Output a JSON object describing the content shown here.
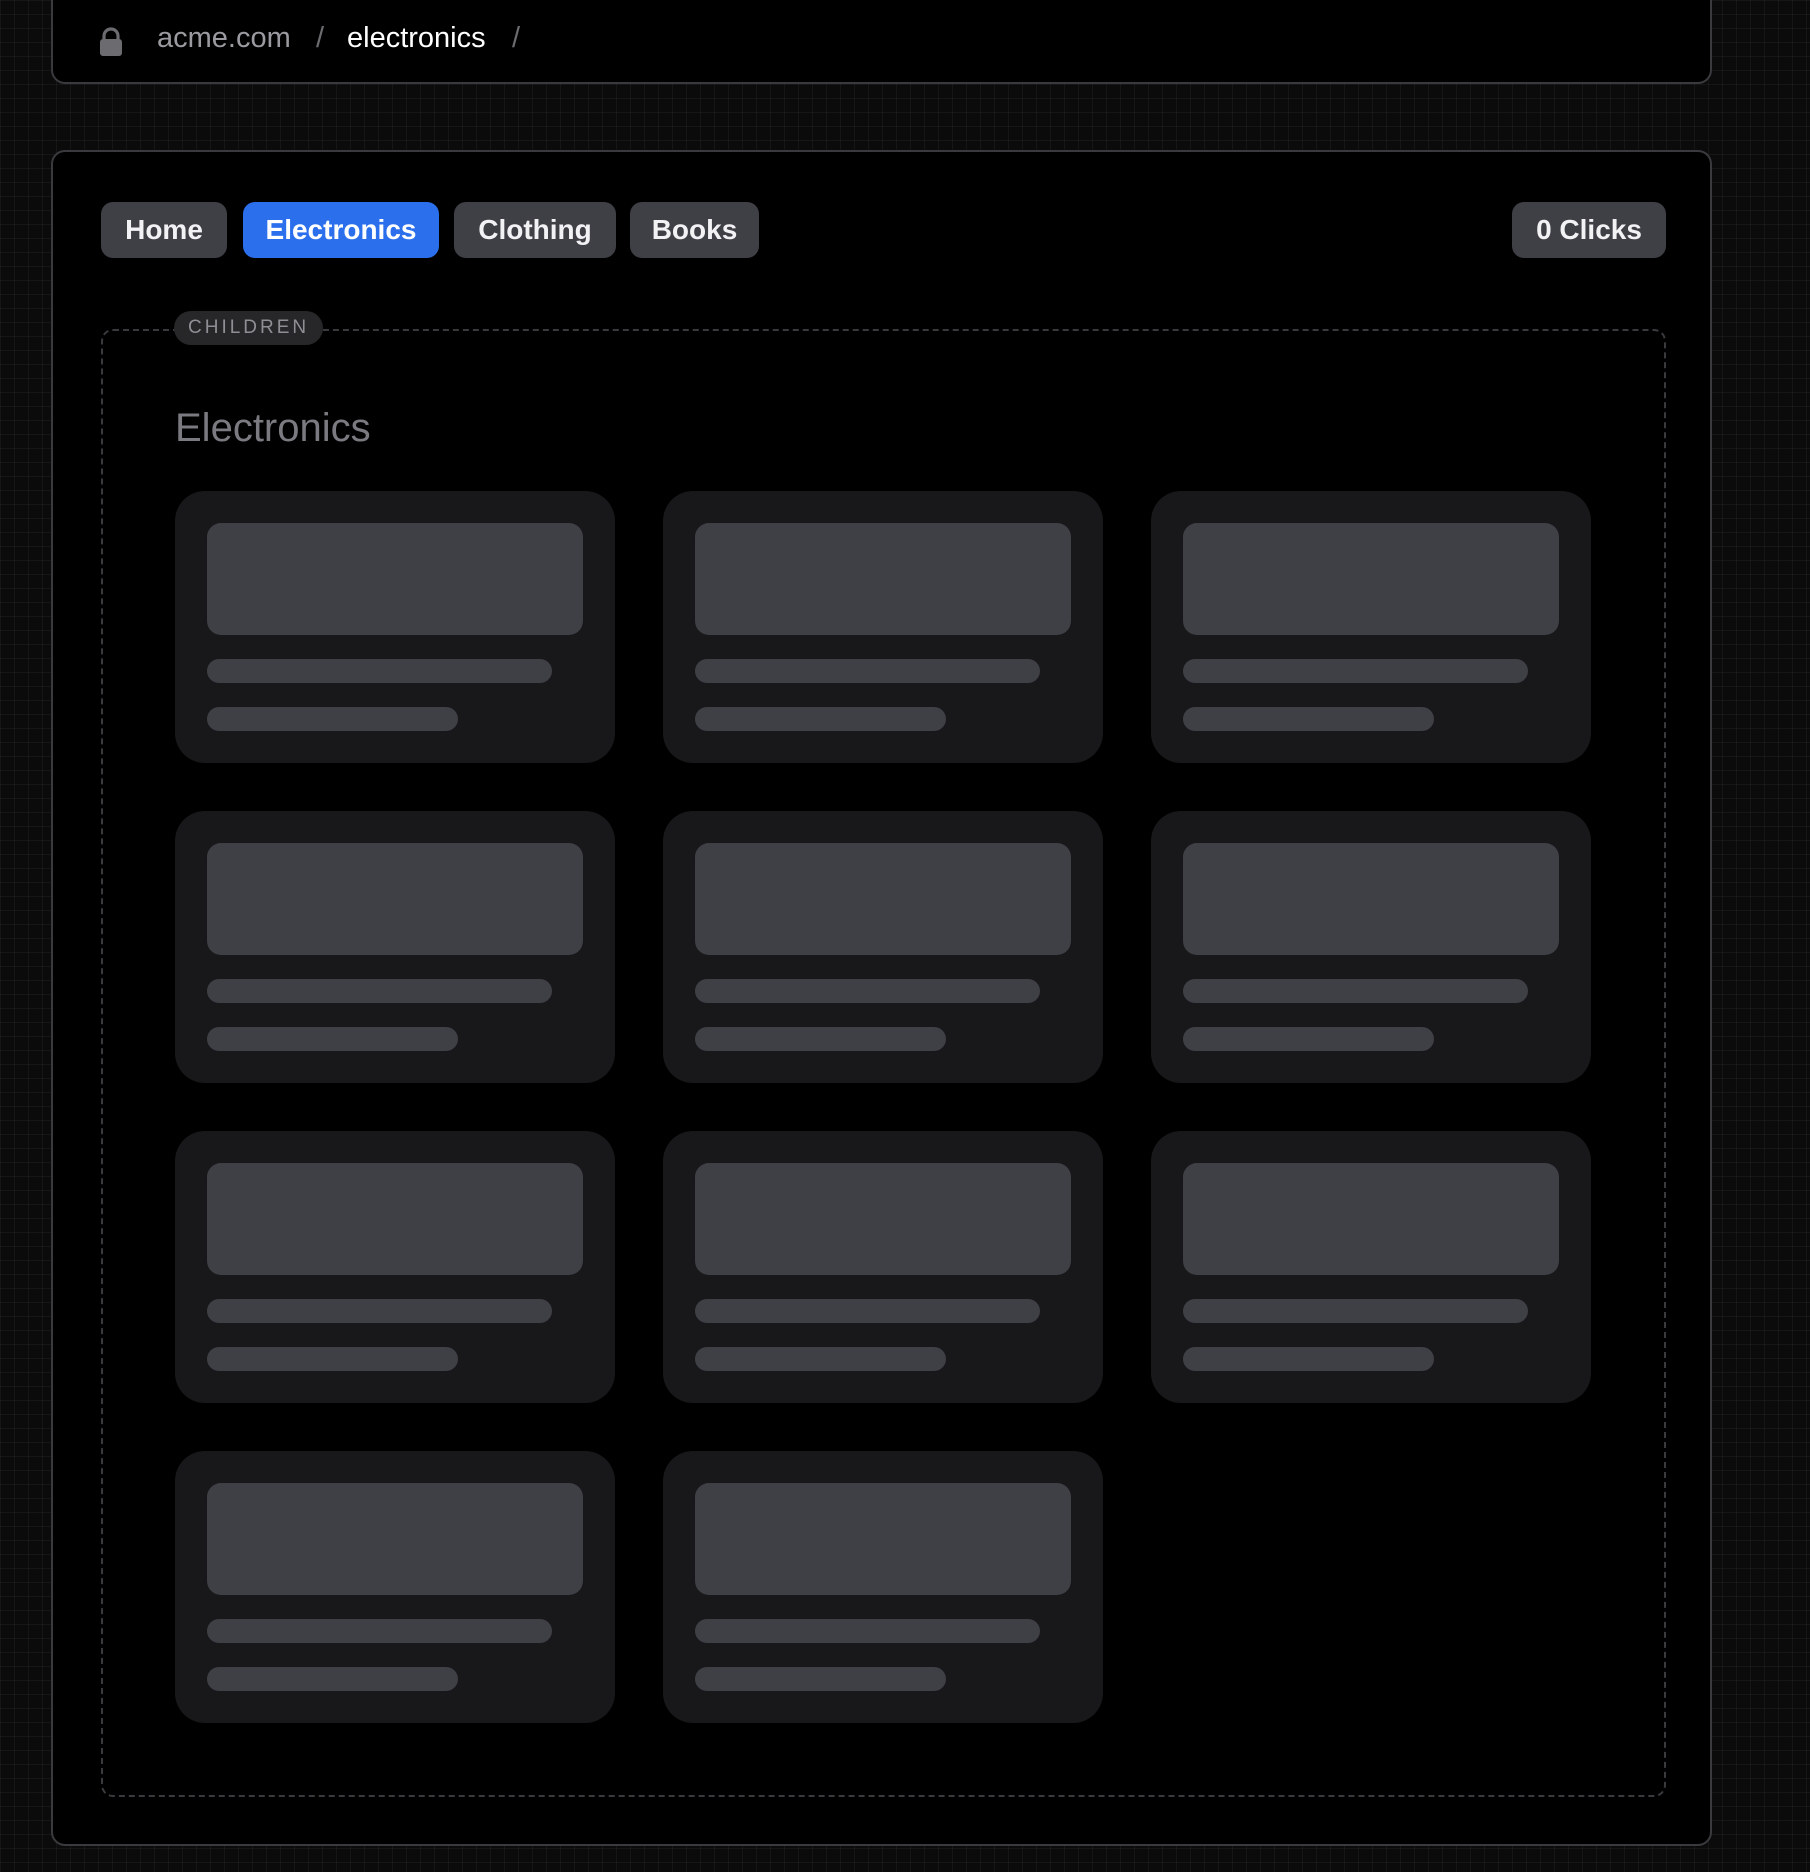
{
  "address_bar": {
    "lock_icon": "lock-icon",
    "breadcrumb": {
      "domain": "acme.com",
      "separator": "/",
      "current": "electronics"
    }
  },
  "nav": {
    "items": [
      {
        "label": "Home",
        "active": false
      },
      {
        "label": "Electronics",
        "active": true
      },
      {
        "label": "Clothing",
        "active": false
      },
      {
        "label": "Books",
        "active": false
      }
    ],
    "clicks_label": "0 Clicks"
  },
  "children": {
    "label": "CHILDREN",
    "section_title": "Electronics",
    "skeleton_card_count": 11
  },
  "colors": {
    "accent": "#2b6fec",
    "panel_bg": "#000000",
    "card_bg": "#18181b",
    "skeleton": "#3f3f46",
    "button_bg": "#3f3f46"
  }
}
